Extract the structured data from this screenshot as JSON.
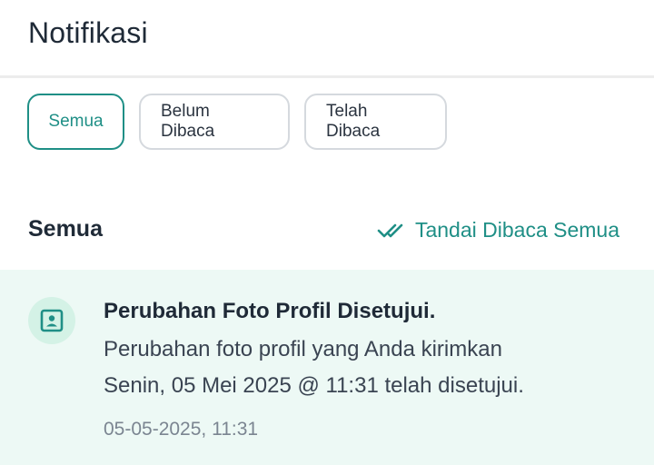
{
  "header": {
    "title": "Notifikasi"
  },
  "filters": [
    {
      "label": "Semua",
      "active": true
    },
    {
      "label": "Belum Dibaca",
      "active": false
    },
    {
      "label": "Telah Dibaca",
      "active": false
    }
  ],
  "section": {
    "title": "Semua",
    "mark_all_label": "Tandai Dibaca Semua",
    "mark_all_icon": "double-check-icon"
  },
  "notifications": [
    {
      "icon": "profile-portrait-icon",
      "title": "Perubahan Foto Profil Disetujui.",
      "body_line1": "Perubahan foto profil yang Anda kirimkan",
      "body_line2": "Senin, 05 Mei 2025 @ 11:31 telah disetujui.",
      "timestamp": "05-05-2025, 11:31",
      "unread": true
    }
  ],
  "colors": {
    "accent": "#1f8f86",
    "unread_background": "#edf9f5",
    "icon_background": "#d4f2e6"
  }
}
